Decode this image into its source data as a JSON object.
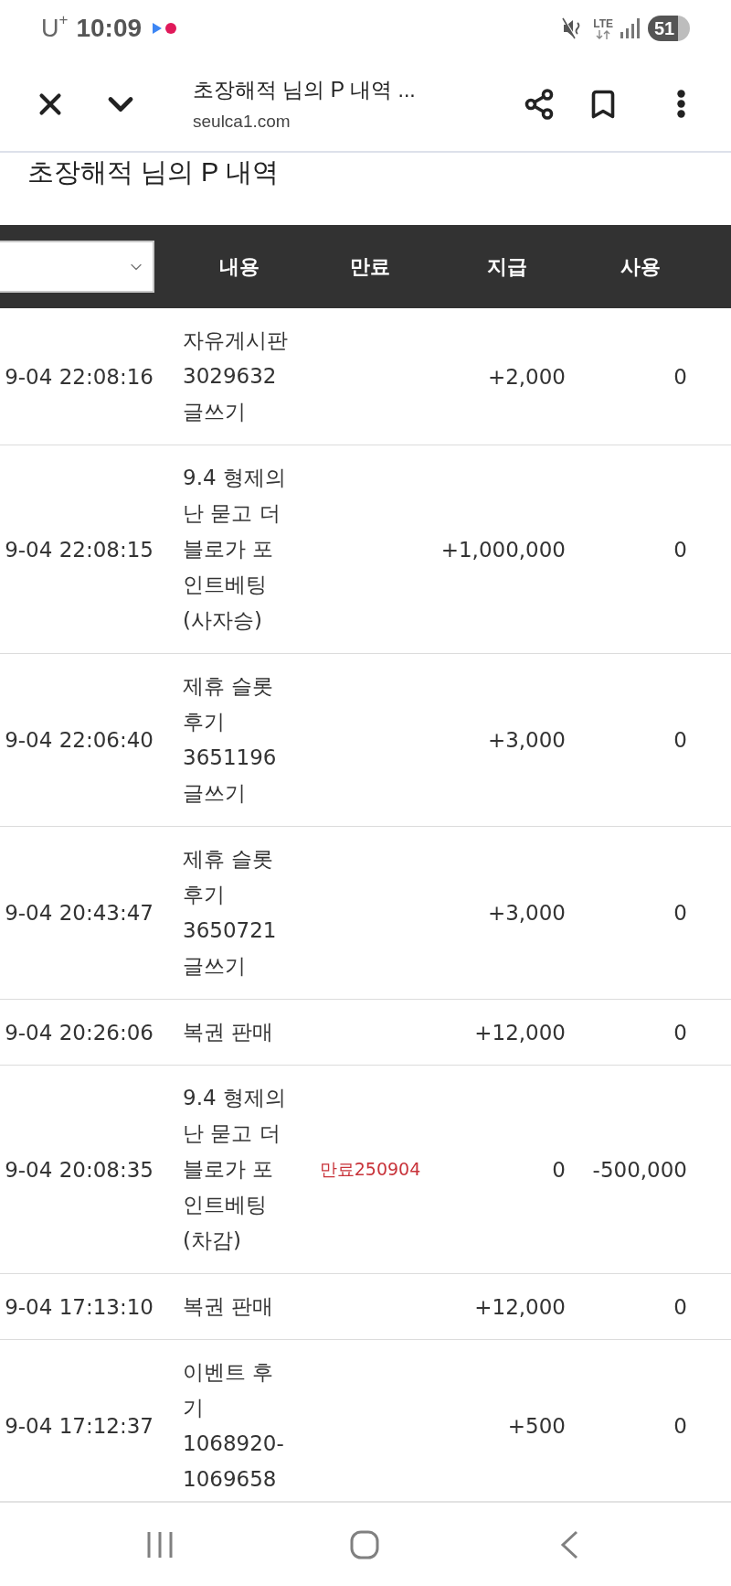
{
  "status_bar": {
    "carrier": "U$^{+}$",
    "time": "10:09",
    "network": "LTE",
    "battery": "51"
  },
  "browser_toolbar": {
    "title": "초장해적 님의 P 내역 ...",
    "url": "seulca1.com"
  },
  "page": {
    "heading": "초장해적 님의 P 내역"
  },
  "table": {
    "columns": [
      "내용",
      "만료",
      "지급",
      "사용"
    ],
    "rows": [
      {
        "date": "9-04 22:08:16",
        "description": "자유게시판 3029632 글쓰기",
        "granted": "+2,000",
        "used": "0"
      },
      {
        "date": "9-04 22:08:15",
        "description": "9.4 형제의 난 묻고 더 블로가 포인트베팅 (사자승)",
        "granted": "+1,000,000",
        "used": "0"
      },
      {
        "date": "9-04 22:06:40",
        "description": "제휴 슬롯 후기 3651196 글쓰기",
        "granted": "+3,000",
        "used": "0"
      },
      {
        "date": "9-04 20:43:47",
        "description": "제휴 슬롯 후기 3650721 글쓰기",
        "granted": "+3,000",
        "used": "0"
      },
      {
        "date": "9-04 20:26:06",
        "description": "복권 판매",
        "granted": "+12,000",
        "used": "0"
      },
      {
        "date": "9-04 20:08:35",
        "description": "9.4 형제의 난 묻고 더 블로가 포인트베팅 (차감)",
        "expiry": "만료250904",
        "granted": "0",
        "used": "-500,000"
      },
      {
        "date": "9-04 17:13:10",
        "description": "복권 판매",
        "granted": "+12,000",
        "used": "0"
      },
      {
        "date": "9-04 17:12:37",
        "description": "이벤트 후기 1068920-1069658",
        "granted": "+500",
        "used": "0"
      }
    ]
  }
}
